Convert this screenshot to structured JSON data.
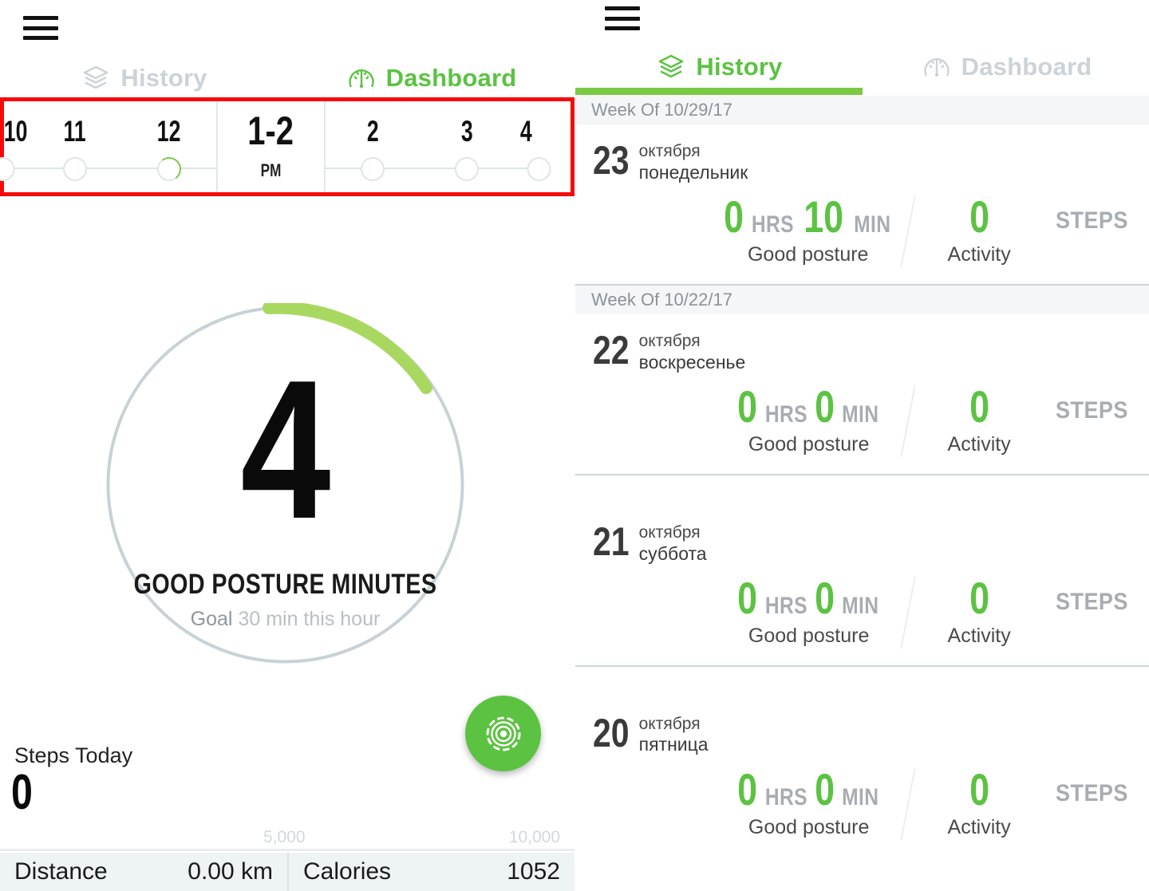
{
  "accent_green": "#5cc242",
  "accent_green_light": "#7ac943",
  "highlight_red": "#f50b0b",
  "muted_gray": "#ccd3d8",
  "dashboard_screen": {
    "menu_icon": "hamburger-menu-icon",
    "tabs": [
      {
        "label": "History",
        "icon": "layers-icon",
        "active": false
      },
      {
        "label": "Dashboard",
        "icon": "gauge-icon",
        "active": true
      }
    ],
    "hour_timeline": {
      "highlighted": true,
      "hours": [
        {
          "label": "10",
          "clipped": "left",
          "progress": 0
        },
        {
          "label": "11",
          "progress": 0
        },
        {
          "label": "12",
          "progress": 12
        },
        {
          "label": "1-2",
          "sublabel": "PM",
          "active": true
        },
        {
          "label": "2",
          "progress": 0
        },
        {
          "label": "3",
          "progress": 0
        },
        {
          "label": "4",
          "clipped": "right",
          "progress": 0
        }
      ]
    },
    "gauge": {
      "value": "4",
      "caption": "GOOD POSTURE MINUTES",
      "goal_prefix": "Goal",
      "goal_text": "30 min this hour",
      "goal_minutes": 30,
      "progress_percent": 13
    },
    "calibrate_button": {
      "icon": "target-calibrate-icon",
      "label": ""
    },
    "steps": {
      "label": "Steps Today",
      "value": "0",
      "scale_mid": "5,000",
      "scale_max": "10,000",
      "progress_percent": 0
    },
    "bottom_stats": [
      {
        "name": "Distance",
        "value": "0.00 km"
      },
      {
        "name": "Calories",
        "value": "1052"
      }
    ]
  },
  "history_screen": {
    "menu_icon": "hamburger-menu-icon",
    "tabs": [
      {
        "label": "History",
        "icon": "layers-icon",
        "active": true
      },
      {
        "label": "Dashboard",
        "icon": "gauge-icon",
        "active": false
      }
    ],
    "units": {
      "hrs": "HRS",
      "min": "MIN",
      "steps": "STEPS"
    },
    "sub_labels": {
      "posture": "Good posture",
      "activity": "Activity"
    },
    "groups": [
      {
        "week_label": "Week Of 10/29/17",
        "days": [
          {
            "day": "23",
            "month": "октября",
            "weekday": "понедельник",
            "hours": "0",
            "minutes": "10",
            "steps": "0"
          }
        ]
      },
      {
        "week_label": "Week Of 10/22/17",
        "days": [
          {
            "day": "22",
            "month": "октября",
            "weekday": "воскресенье",
            "hours": "0",
            "minutes": "0",
            "steps": "0"
          },
          {
            "day": "21",
            "month": "октября",
            "weekday": "суббота",
            "hours": "0",
            "minutes": "0",
            "steps": "0"
          },
          {
            "day": "20",
            "month": "октября",
            "weekday": "пятница",
            "hours": "0",
            "minutes": "0",
            "steps": "0"
          }
        ]
      }
    ]
  }
}
